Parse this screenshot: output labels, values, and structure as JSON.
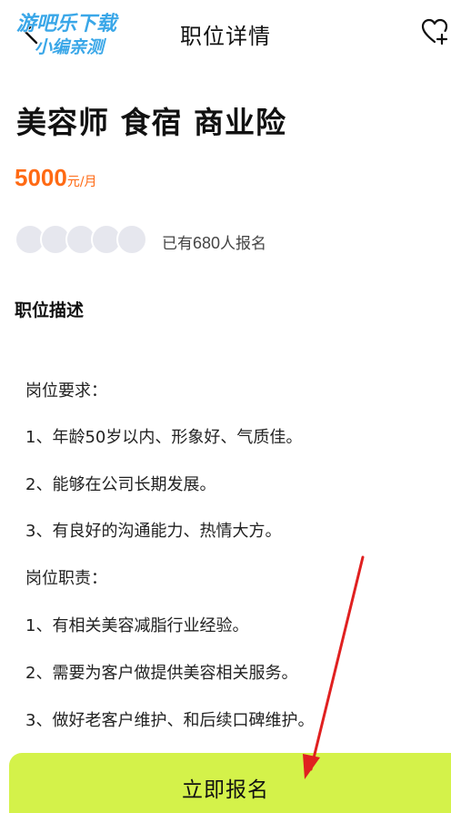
{
  "watermark": {
    "line1": "游吧乐下载",
    "line2": "小编亲测"
  },
  "header": {
    "title": "职位详情",
    "back_icon": "chevron-left-icon",
    "favorite_icon": "heart-plus-icon"
  },
  "job": {
    "title": "美容师 食宿 商业险",
    "salary_amount": "5000",
    "salary_unit": "元/月"
  },
  "applicants": {
    "prefix": "已有",
    "count": "680",
    "suffix": "人报名",
    "avatar_count": 5
  },
  "description": {
    "section_title": "职位描述",
    "lines": [
      "岗位要求：",
      "1、年龄50岁以内、形象好、气质佳。",
      "2、能够在公司长期发展。",
      "3、有良好的沟通能力、热情大方。",
      "岗位职责：",
      "1、有相关美容减脂行业经验。",
      "2、需要为客户做提供美容相关服务。",
      "3、做好老客户维护、和后续口碑维护。"
    ]
  },
  "footer": {
    "apply_label": "立即报名"
  },
  "colors": {
    "salary": "#ff6a14",
    "button_bg": "#d4f24a",
    "watermark": "#3aa7e8",
    "annotation_arrow": "#e02020"
  }
}
